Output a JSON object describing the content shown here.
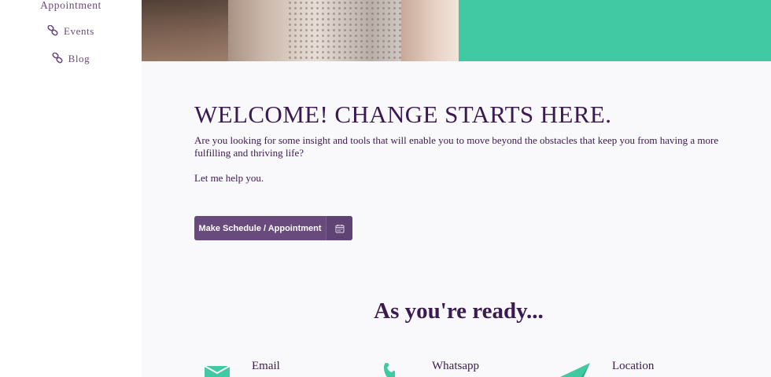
{
  "sidebar": {
    "items": [
      {
        "label": "Appointment",
        "icon": "none"
      },
      {
        "label": "Events",
        "icon": "link-icon"
      },
      {
        "label": "Blog",
        "icon": "link-icon"
      }
    ]
  },
  "hero": {
    "accent_color": "#40c9a2"
  },
  "main": {
    "heading": "WELCOME! CHANGE STARTS HERE.",
    "intro": "Are you looking for some insight and tools that will enable you to move beyond the obstacles that keep you from having a more fulfilling and thriving life?",
    "help": "Let me help you.",
    "cta_label": "Make Schedule / Appointment",
    "cta_icon": "calendar-icon",
    "cta_color": "#684a7d",
    "ready_heading": "As you're ready...",
    "contacts": [
      {
        "label": "Email",
        "icon": "envelope-icon"
      },
      {
        "label": "Whatsapp",
        "icon": "phone-icon"
      },
      {
        "label": "Location",
        "icon": "paper-plane-icon"
      }
    ]
  }
}
